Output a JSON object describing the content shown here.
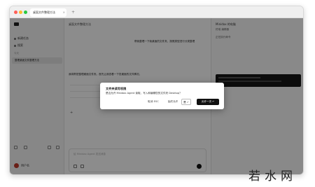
{
  "window": {
    "tab_title": "桌面文件整理方法",
    "tab_close": "×",
    "new_tab": "+"
  },
  "sidebar": {
    "items": [
      {
        "label": "新建任务"
      },
      {
        "label": "搜索"
      }
    ],
    "section_label": "今天",
    "active_item": "整理桌面文件整理方法",
    "user_name": "用户名"
  },
  "main": {
    "header": "桌面文件整理方法",
    "bubble_text": "帮我整理一下我桌面的文件夹，按照类型进行分类整理",
    "chat_text": "我将帮您整理桌面文件夹。首先让我查看一下您桌面的文件情况。",
    "plus": "+",
    "composer_placeholder": "给 Minidax Agent 发送消息"
  },
  "right_panel": {
    "title": "Minidax 的电脑",
    "tabs": "终端  编辑器",
    "card_text": "正在执行命令"
  },
  "dialog": {
    "title": "文件夹读写权限",
    "body": "是否允许 Minidax Agent 读取、写入和编辑您的文件夹 Desktop？",
    "cancel_label": "取消",
    "cancel_key": "ESC",
    "sometimes_label": "始终允许",
    "toggle_label": "是",
    "allow_label": "允许一次",
    "allow_key": "↵"
  },
  "watermark": {
    "text": "若水网"
  },
  "colors": {
    "allow_button": "#111111",
    "overlay": "rgba(0,0,0,0.45)"
  }
}
